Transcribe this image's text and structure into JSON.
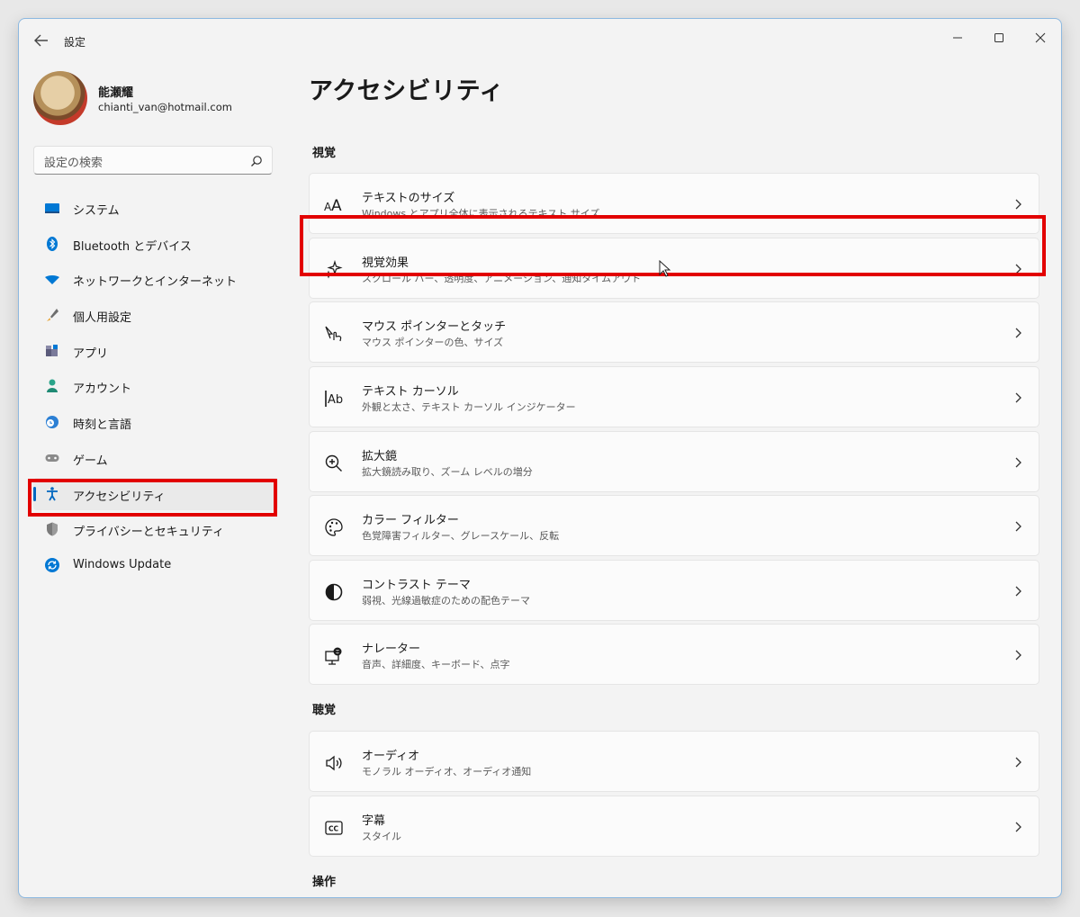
{
  "window": {
    "title": "設定"
  },
  "user": {
    "name": "能瀬耀",
    "email": "chianti_van@hotmail.com"
  },
  "search": {
    "placeholder": "設定の検索"
  },
  "sidebar": {
    "items": [
      {
        "label": "システム",
        "icon": "system-icon",
        "active": false
      },
      {
        "label": "Bluetooth とデバイス",
        "icon": "bluetooth-icon",
        "active": false
      },
      {
        "label": "ネットワークとインターネット",
        "icon": "wifi-icon",
        "active": false
      },
      {
        "label": "個人用設定",
        "icon": "brush-icon",
        "active": false
      },
      {
        "label": "アプリ",
        "icon": "apps-icon",
        "active": false
      },
      {
        "label": "アカウント",
        "icon": "account-icon",
        "active": false
      },
      {
        "label": "時刻と言語",
        "icon": "globe-clock-icon",
        "active": false
      },
      {
        "label": "ゲーム",
        "icon": "gamepad-icon",
        "active": false
      },
      {
        "label": "アクセシビリティ",
        "icon": "accessibility-icon",
        "active": true
      },
      {
        "label": "プライバシーとセキュリティ",
        "icon": "shield-icon",
        "active": false
      },
      {
        "label": "Windows Update",
        "icon": "update-icon",
        "active": false
      }
    ]
  },
  "main": {
    "title": "アクセシビリティ",
    "sections": [
      {
        "title": "視覚",
        "cards": [
          {
            "title": "テキストのサイズ",
            "subtitle": "Windows とアプリ全体に表示されるテキスト サイズ",
            "icon": "text-size-icon"
          },
          {
            "title": "視覚効果",
            "subtitle": "スクロール バー、透明度、アニメーション、通知タイムアウト",
            "icon": "sparkle-icon"
          },
          {
            "title": "マウス ポインターとタッチ",
            "subtitle": "マウス ポインターの色、サイズ",
            "icon": "pointer-touch-icon"
          },
          {
            "title": "テキスト カーソル",
            "subtitle": "外観と太さ、テキスト カーソル インジケーター",
            "icon": "text-cursor-icon"
          },
          {
            "title": "拡大鏡",
            "subtitle": "拡大鏡読み取り、ズーム レベルの増分",
            "icon": "magnifier-icon"
          },
          {
            "title": "カラー フィルター",
            "subtitle": "色覚障害フィルター、グレースケール、反転",
            "icon": "palette-icon"
          },
          {
            "title": "コントラスト テーマ",
            "subtitle": "弱視、光線過敏症のための配色テーマ",
            "icon": "contrast-icon"
          },
          {
            "title": "ナレーター",
            "subtitle": "音声、詳細度、キーボード、点字",
            "icon": "narrator-icon"
          }
        ]
      },
      {
        "title": "聴覚",
        "cards": [
          {
            "title": "オーディオ",
            "subtitle": "モノラル オーディオ、オーディオ通知",
            "icon": "speaker-icon"
          },
          {
            "title": "字幕",
            "subtitle": "スタイル",
            "icon": "captions-icon"
          }
        ]
      },
      {
        "title": "操作",
        "cards": []
      }
    ]
  },
  "colors": {
    "accent": "#0067c0",
    "highlight": "#e20000"
  }
}
